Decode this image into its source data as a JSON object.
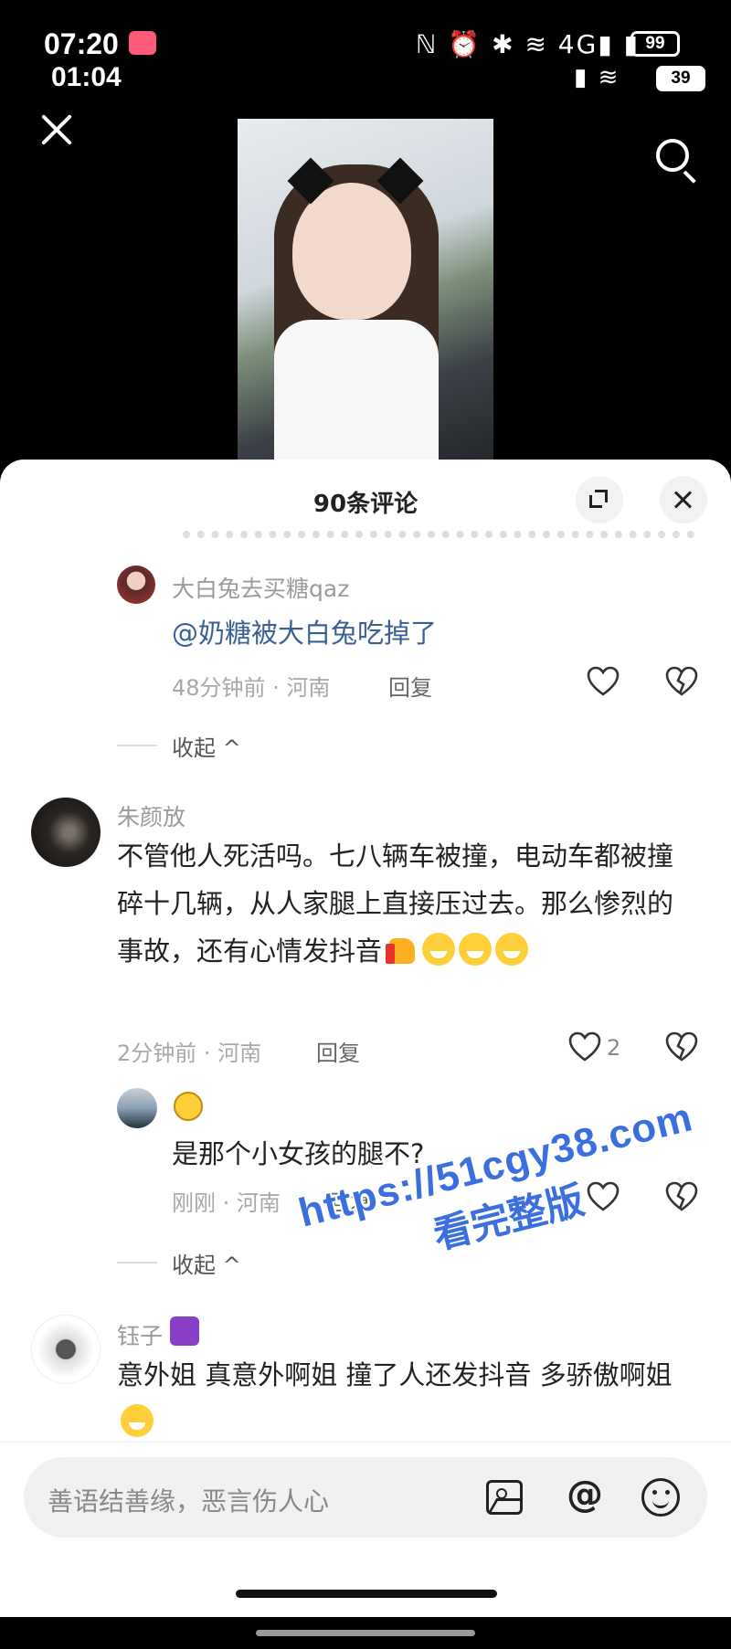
{
  "status_bar": {
    "time_primary": "07:20",
    "time_secondary": "01:04",
    "icons_row1": "ℕ ⏰ ✱ ≋ 4G▮ ▮",
    "icons_row2": "▮ ≋",
    "battery_primary": "99",
    "battery_secondary": "39"
  },
  "sheet": {
    "title": "90条评论"
  },
  "comments": [
    {
      "author": "大白兔去买糖qaz",
      "text": "@奶糖被大白兔吃掉了",
      "meta": "48分钟前 · 河南",
      "reply_label": "回复",
      "likes": ""
    },
    {
      "collapse_label": "收起 ^"
    },
    {
      "author": "朱颜放",
      "text": "不管他人死活吗。七八辆车被撞，电动车都被撞碎十几辆，从人家腿上直接压过去。那么惨烈的事故，还有心情发抖音",
      "meta": "2分钟前 · 河南",
      "reply_label": "回复",
      "likes": "2"
    },
    {
      "author": "",
      "text": "是那个小女孩的腿不?",
      "meta": "刚刚 · 河南",
      "reply_label": "回复",
      "likes": ""
    },
    {
      "collapse_label": "收起 ^"
    },
    {
      "author": "钰子",
      "text": "意外姐 真意外啊姐 撞了人还发抖音 多骄傲啊姐"
    }
  ],
  "watermark": {
    "line1": "https://51cgy38.com",
    "line2": "看完整版"
  },
  "input": {
    "placeholder": "善语结善缘，恶言伤人心",
    "at_symbol": "@"
  },
  "colors": {
    "mention": "#3a5f95",
    "watermark": "#3b6fe0",
    "badge": "#ff5a7a"
  }
}
